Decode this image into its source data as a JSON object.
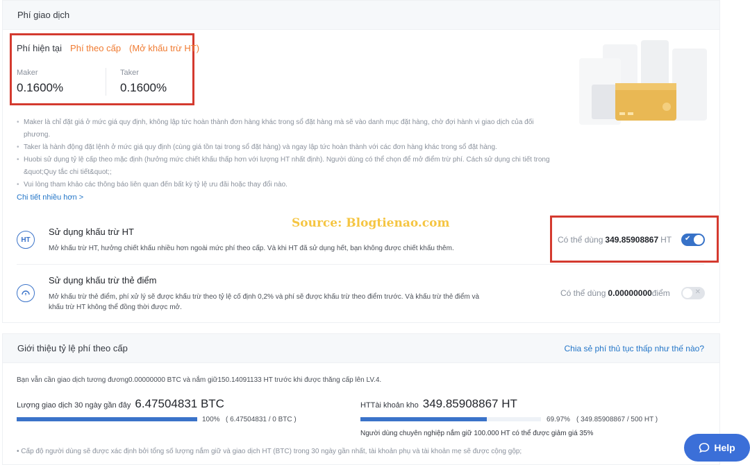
{
  "fee_section": {
    "title": "Phí giao dịch",
    "current_label": "Phí hiện tại",
    "tier_label": "Phí theo cấp",
    "ht_unlock_label": "(Mở khấu trừ HT)",
    "maker_label": "Maker",
    "maker_value": "0.1600%",
    "taker_label": "Taker",
    "taker_value": "0.1600%",
    "notes": [
      "Maker là chỉ đặt giá ở mức giá quy định, không lập tức hoàn thành đơn hàng khác trong sổ đặt hàng mà sẽ vào danh mục đặt hàng, chờ đợi hành vi giao dịch của đối phương.",
      "Taker là hành động đặt lệnh ở mức giá quy định (cùng giá tồn tại trong sổ đặt hàng) và ngay lập tức hoàn thành với các đơn hàng khác trong sổ đặt hàng.",
      "Huobi sử dụng tỷ lệ cấp theo mặc định (hưởng mức chiết khấu thấp hơn với lượng HT nhất định). Người dùng có thể chọn để mở điểm trừ phí. Cách sử dụng chi tiết trong &quot;Quy tắc chi tiết&quot;;",
      "Vui lòng tham khảo các thông báo liên quan đến bất kỳ tỷ lệ ưu đãi hoặc thay đổi nào."
    ],
    "more_link": "Chi tiết nhiều hơn >",
    "watermark": "Source: Blogtienao.com",
    "ht_deduction": {
      "icon_text": "HT",
      "title": "Sử dụng khấu trừ HT",
      "desc": "Mở khấu trừ HT, hưởng chiết khấu nhiều hơn ngoài mức phí theo cấp. Và khi HT đã sử dụng hết, bạn không được chiết khấu thêm.",
      "available_label": "Có thể dùng",
      "available_value": "349.85908867",
      "available_unit": "HT",
      "enabled": true
    },
    "point_deduction": {
      "title": "Sử dụng khấu trừ thẻ điểm",
      "desc_line1": "Mở khấu trừ thẻ điểm, phí xử lý sẽ được khấu trừ theo tỷ lệ cố định 0,2% và phí sẽ được khấu trừ theo điểm trước. Và khấu trừ thẻ điểm và",
      "desc_line2": "khấu trừ HT không thể đồng thời được mở.",
      "available_label": "Có thể dùng",
      "available_value": "0.00000000",
      "available_unit": "điểm",
      "enabled": false
    }
  },
  "tier_section": {
    "title": "Giới thiệu tỷ lệ phí theo cấp",
    "share_link": "Chia sẻ phí thủ tục thấp như thế nào?",
    "info": "Bạn vẫn cần giao dịch tương đương0.00000000 BTC và nắm giữ150.14091133 HT trước khi được thăng cấp lên LV.4.",
    "volume_label": "Lượng giao dịch 30 ngày gần đây",
    "volume_value": "6.47504831 BTC",
    "volume_percent": "100%",
    "volume_detail": "( 6.47504831 / 0 BTC )",
    "volume_progress": 1.0,
    "holding_label": "HTTài khoản kho",
    "holding_value": "349.85908867 HT",
    "holding_percent": "69.97%",
    "holding_detail": "( 349.85908867 / 500 HT )",
    "holding_progress": 0.6997,
    "promo": "Người dùng chuyên nghiệp nắm giữ 100.000 HT có thể được giảm giá 35%",
    "footnote": "Cấp độ người dùng sẽ được xác định bởi tổng số lượng nắm giữ và giao dịch HT (BTC) trong 30 ngày gần nhất, tài khoản phụ và tài khoản mẹ sẽ được cộng gộp;"
  },
  "help_button": "Help",
  "colors": {
    "accent": "#3772c8",
    "highlight": "#d43a2f",
    "orange": "#f07b31"
  }
}
